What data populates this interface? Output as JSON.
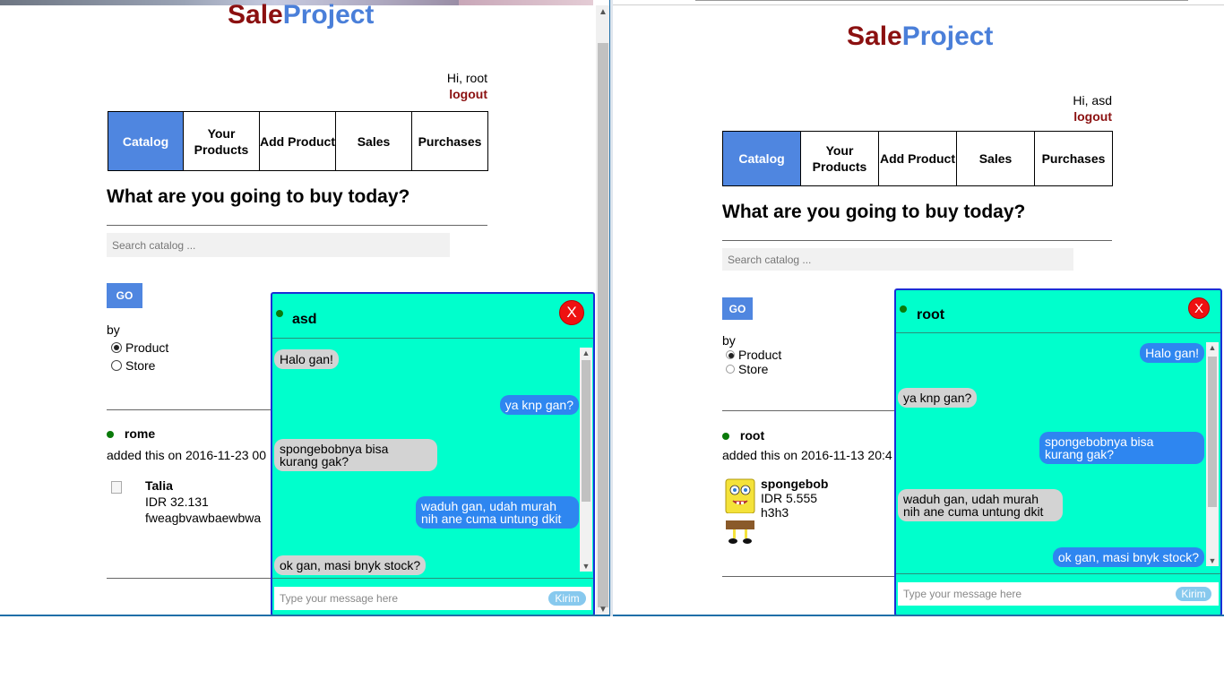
{
  "left": {
    "logo": {
      "part1": "Sale",
      "part2": "Project"
    },
    "greeting": "Hi, root",
    "logout": "logout",
    "nav": [
      "Catalog",
      "Your Products",
      "Add Product",
      "Sales",
      "Purchases"
    ],
    "heading": "What are you going to buy today?",
    "search_placeholder": "Search catalog ...",
    "go": "GO",
    "by": "by",
    "radio_product": "Product",
    "radio_store": "Store",
    "seller": "rome",
    "added": "added this on 2016-11-23 00",
    "product": {
      "name": "Talia",
      "price": "IDR 32.131",
      "desc": "fweagbvawbaewbwa"
    },
    "chat": {
      "partner": "asd",
      "close": "X",
      "messages": [
        {
          "dir": "in",
          "text": "Halo gan!"
        },
        {
          "dir": "out",
          "text": "ya knp gan?"
        },
        {
          "dir": "in",
          "text": "spongebobnya bisa\nkurang gak?"
        },
        {
          "dir": "out",
          "text": "waduh gan, udah murah\nnih ane cuma untung dkit"
        },
        {
          "dir": "in",
          "text": "ok gan, masi bnyk stock?"
        }
      ],
      "input_placeholder": "Type your message here",
      "send": "Kirim"
    }
  },
  "right": {
    "logo": {
      "part1": "Sale",
      "part2": "Project"
    },
    "greeting": "Hi, asd",
    "logout": "logout",
    "nav": [
      "Catalog",
      "Your Products",
      "Add Product",
      "Sales",
      "Purchases"
    ],
    "heading": "What are you going to buy today?",
    "search_placeholder": "Search catalog ...",
    "go": "GO",
    "by": "by",
    "radio_product": "Product",
    "radio_store": "Store",
    "seller": "root",
    "added": "added this on 2016-11-13 20:4",
    "product": {
      "name": "spongebob",
      "price": "IDR 5.555",
      "desc": "h3h3"
    },
    "chat": {
      "partner": "root",
      "close": "X",
      "messages": [
        {
          "dir": "out",
          "text": "Halo gan!"
        },
        {
          "dir": "in",
          "text": "ya knp gan?"
        },
        {
          "dir": "out",
          "text": "spongebobnya bisa\nkurang gak?"
        },
        {
          "dir": "in",
          "text": "waduh gan, udah murah\nnih ane cuma untung dkit"
        },
        {
          "dir": "out",
          "text": "ok gan, masi bnyk stock?"
        }
      ],
      "input_placeholder": "Type your message here",
      "send": "Kirim"
    }
  }
}
